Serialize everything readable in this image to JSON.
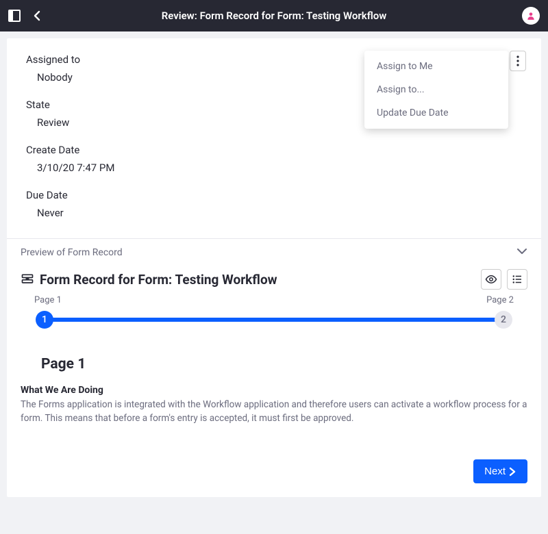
{
  "header": {
    "title": "Review: Form Record for Form: Testing Workflow"
  },
  "fields": {
    "assigned_to": {
      "label": "Assigned to",
      "value": "Nobody"
    },
    "state": {
      "label": "State",
      "value": "Review"
    },
    "create_date": {
      "label": "Create Date",
      "value": "3/10/20 7:47 PM"
    },
    "due_date": {
      "label": "Due Date",
      "value": "Never"
    }
  },
  "dropdown": {
    "assign_me": "Assign to Me",
    "assign_to": "Assign to...",
    "update_due": "Update Due Date"
  },
  "preview": {
    "header": "Preview of Form Record",
    "form_title": "Form Record for Form: Testing Workflow",
    "pager": {
      "left_label": "Page 1",
      "right_label": "Page 2",
      "one": "1",
      "two": "2"
    },
    "page1": {
      "heading": "Page 1",
      "section_title": "What We Are Doing",
      "section_body": "The Forms application is integrated with the Workflow application and therefore users can activate a workflow process for a form. This means that before a form's entry is accepted, it must first be approved."
    },
    "next": "Next"
  }
}
